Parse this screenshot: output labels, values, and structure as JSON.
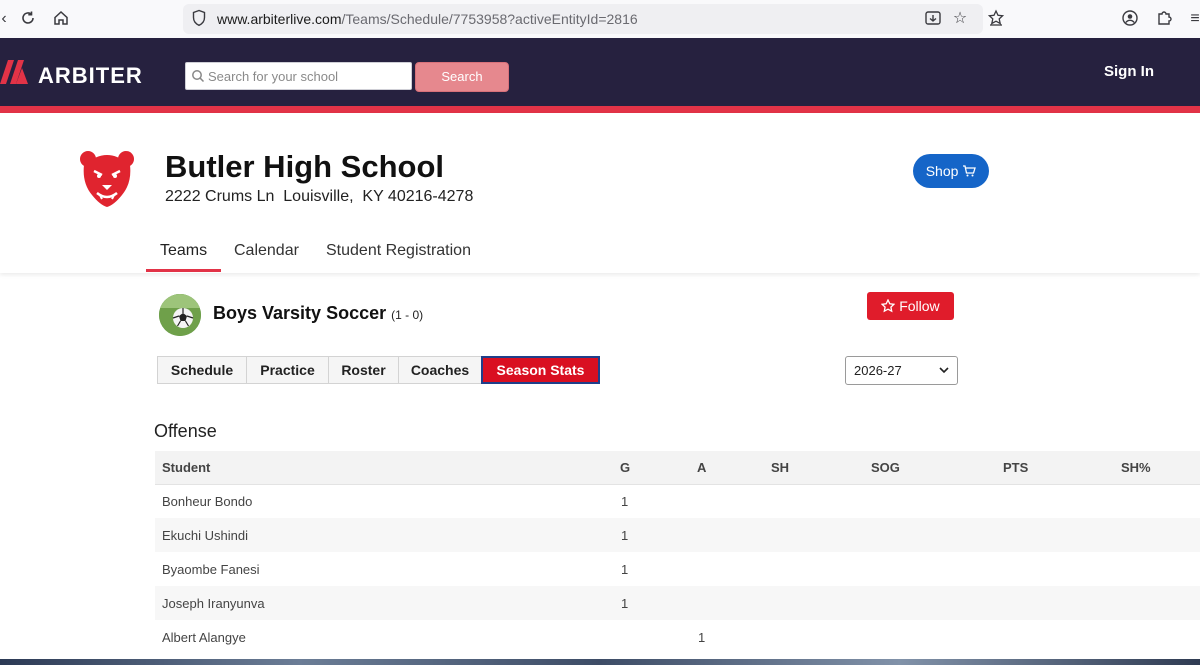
{
  "browser": {
    "url_host": "www.arbiterlive.com",
    "url_path": "/Teams/Schedule/7753958?activeEntityId=2816"
  },
  "header": {
    "logo_text": "ARBITER",
    "search_placeholder": "Search for your school",
    "search_button": "Search",
    "sign_in": "Sign In",
    "brand_color": "#26213f",
    "accent_color": "#e23347"
  },
  "school": {
    "name": "Butler High School",
    "address": "2222 Crums Ln  Louisville,  KY 40216-4278",
    "shop_label": "Shop",
    "nav": [
      "Teams",
      "Calendar",
      "Student Registration"
    ],
    "active_nav": "Teams"
  },
  "team": {
    "name": "Boys Varsity Soccer",
    "record": "(1 - 0)",
    "follow_label": "Follow",
    "tabs": [
      "Schedule",
      "Practice",
      "Roster",
      "Coaches",
      "Season Stats"
    ],
    "active_tab": "Season Stats",
    "season": "2026-27"
  },
  "offense": {
    "title": "Offense",
    "columns": [
      "Student",
      "G",
      "A",
      "SH",
      "SOG",
      "PTS",
      "SH%"
    ],
    "rows": [
      [
        "Bonheur Bondo",
        "1",
        "",
        "",
        "",
        "",
        ""
      ],
      [
        "Ekuchi Ushindi",
        "1",
        "",
        "",
        "",
        "",
        ""
      ],
      [
        "Byaombe Fanesi",
        "1",
        "",
        "",
        "",
        "",
        ""
      ],
      [
        "Joseph Iranyunva",
        "1",
        "",
        "",
        "",
        "",
        ""
      ],
      [
        "Albert Alangye",
        "",
        "1",
        "",
        "",
        "",
        ""
      ]
    ]
  }
}
